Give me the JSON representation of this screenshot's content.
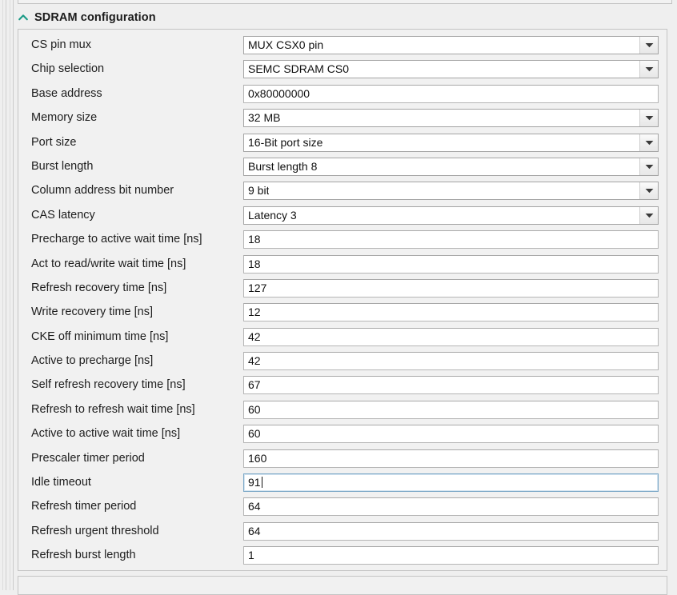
{
  "section": {
    "title": "SDRAM configuration",
    "collapse_icon": "chevron-up-icon",
    "expanded": true,
    "accent_color": "#1a9a86"
  },
  "theme": {
    "panel_background": "#f1f1f1",
    "panel_border": "#c4c4c4",
    "field_background": "#ffffff",
    "field_border": "#b5b5b5",
    "focus_border": "#7aa7c7",
    "label_color": "#1d1d1d",
    "value_color": "#111111"
  },
  "fields": [
    {
      "label": "CS pin mux",
      "value": "MUX CSX0 pin",
      "type": "combo",
      "focused": false
    },
    {
      "label": "Chip selection",
      "value": "SEMC SDRAM CS0",
      "type": "combo",
      "focused": false
    },
    {
      "label": "Base address",
      "value": "0x80000000",
      "type": "text",
      "focused": false
    },
    {
      "label": "Memory size",
      "value": "32 MB",
      "type": "combo",
      "focused": false
    },
    {
      "label": "Port size",
      "value": "16-Bit port size",
      "type": "combo",
      "focused": false
    },
    {
      "label": "Burst length",
      "value": "Burst length 8",
      "type": "combo",
      "focused": false
    },
    {
      "label": "Column address bit number",
      "value": "9 bit",
      "type": "combo",
      "focused": false
    },
    {
      "label": "CAS latency",
      "value": "Latency 3",
      "type": "combo",
      "focused": false
    },
    {
      "label": "Precharge to active wait time [ns]",
      "value": "18",
      "type": "text",
      "focused": false
    },
    {
      "label": "Act to read/write wait time [ns]",
      "value": "18",
      "type": "text",
      "focused": false
    },
    {
      "label": "Refresh recovery time [ns]",
      "value": "127",
      "type": "text",
      "focused": false
    },
    {
      "label": "Write recovery time [ns]",
      "value": "12",
      "type": "text",
      "focused": false
    },
    {
      "label": "CKE off minimum time [ns]",
      "value": "42",
      "type": "text",
      "focused": false
    },
    {
      "label": "Active to precharge [ns]",
      "value": "42",
      "type": "text",
      "focused": false
    },
    {
      "label": "Self refresh recovery time [ns]",
      "value": "67",
      "type": "text",
      "focused": false
    },
    {
      "label": "Refresh to refresh wait time [ns]",
      "value": "60",
      "type": "text",
      "focused": false
    },
    {
      "label": "Active to active wait time [ns]",
      "value": "60",
      "type": "text",
      "focused": false
    },
    {
      "label": "Prescaler timer period",
      "value": "160",
      "type": "text",
      "focused": false
    },
    {
      "label": "Idle timeout",
      "value": "91",
      "type": "text",
      "focused": true
    },
    {
      "label": "Refresh timer period",
      "value": "64",
      "type": "text",
      "focused": false
    },
    {
      "label": "Refresh urgent threshold",
      "value": "64",
      "type": "text",
      "focused": false
    },
    {
      "label": "Refresh burst length",
      "value": "1",
      "type": "text",
      "focused": false
    }
  ]
}
